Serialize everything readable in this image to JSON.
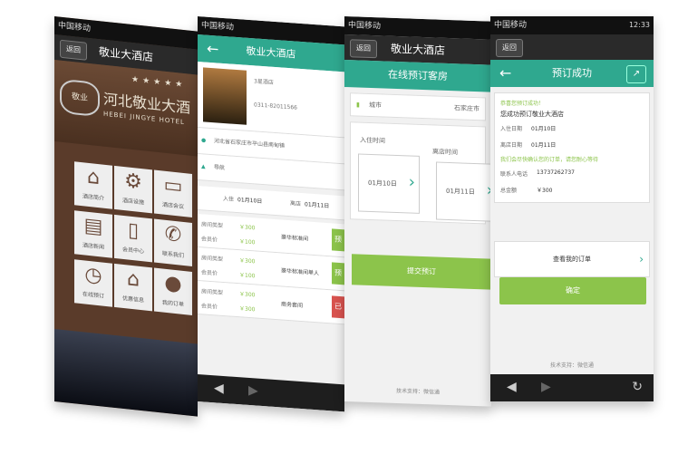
{
  "status": {
    "carrier": "中国移动",
    "time": "12:33"
  },
  "nav": {
    "back_label": "返回"
  },
  "hotel": {
    "name": "敬业大酒店"
  },
  "screen1": {
    "hero_cn": "河北敬业大酒",
    "hero_en": "HEBEI JINGYE HOTEL",
    "logo": "敬业",
    "tiles": [
      {
        "icon": "home-icon",
        "glyph": "⌂",
        "label": "酒店简介"
      },
      {
        "icon": "gear-icon",
        "glyph": "⚙",
        "label": "酒店设施"
      },
      {
        "icon": "monitor-icon",
        "glyph": "▭",
        "label": "酒店会议"
      },
      {
        "icon": "document-icon",
        "glyph": "▤",
        "label": "酒店新闻"
      },
      {
        "icon": "phone-icon",
        "glyph": "▯",
        "label": "会员中心"
      },
      {
        "icon": "call-icon",
        "glyph": "✆",
        "label": "联系我们"
      },
      {
        "icon": "clock-icon",
        "glyph": "◷",
        "label": "在线预订"
      },
      {
        "icon": "tag-icon",
        "glyph": "⌂",
        "label": "优惠信息"
      },
      {
        "icon": "user-icon",
        "glyph": "●",
        "label": "我的订单"
      }
    ]
  },
  "screen2": {
    "header": "敬业大酒店",
    "level": "3星酒店",
    "phone": "0311-82011566",
    "address": "河北省石家庄市平山县南甸镇",
    "nav_label": "导航",
    "checkin_label": "入住",
    "checkin_date": "01月10日",
    "checkout_label": "离店",
    "checkout_date": "01月11日",
    "rooms": [
      {
        "type_label": "房间类型",
        "price_label": "￥300",
        "member_label": "会员价",
        "member_price": "￥100",
        "name": "豪华标准间",
        "btn": "预"
      },
      {
        "type_label": "房间类型",
        "price_label": "￥300",
        "member_label": "会员价",
        "member_price": "￥100",
        "name": "豪华标准间单人",
        "btn": "预"
      },
      {
        "type_label": "房间类型",
        "price_label": "￥300",
        "member_label": "会员价",
        "member_price": "￥300",
        "name": "商务套间",
        "btn": "已"
      }
    ]
  },
  "screen3": {
    "header": "在线预订客房",
    "city_label": "城市",
    "city_value": "石家庄市",
    "checkin_label": "入住时间",
    "checkin_date": "01月10日",
    "checkout_label": "离店时间",
    "checkout_date": "01月11日",
    "submit": "提交预订",
    "footer": "技术支持：微信通"
  },
  "screen4": {
    "header": "预订成功",
    "success_msg": "恭喜您预订成功！",
    "hotel_line": "您成功预订敬业大酒店",
    "checkin_label": "入住日期",
    "checkin_date": "01月10日",
    "checkout_label": "离店日期",
    "checkout_date": "01月11日",
    "note": "我们会尽快确认您的订单，请您耐心等待",
    "contact_label": "联系人电话",
    "contact_value": "13737262737",
    "total_label": "总金额",
    "total_value": "￥300",
    "view_order": "查看我的订单",
    "confirm": "确定",
    "footer": "技术支持：微信通"
  }
}
